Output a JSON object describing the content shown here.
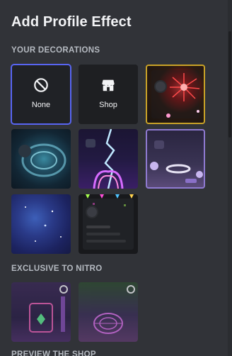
{
  "title": "Add Profile Effect",
  "sections": {
    "your_decorations": "YOUR DECORATIONS",
    "exclusive_nitro": "EXCLUSIVE TO NITRO",
    "preview_shop": "PREVIEW THE SHOP"
  },
  "tiles": {
    "none": {
      "label": "None",
      "icon": "no-symbol-icon",
      "selected": true
    },
    "shop": {
      "label": "Shop",
      "icon": "shop-icon"
    }
  },
  "colors": {
    "background": "#313338",
    "tile": "#1e1f22",
    "accent": "#5865f2",
    "header": "#b5bac1"
  }
}
